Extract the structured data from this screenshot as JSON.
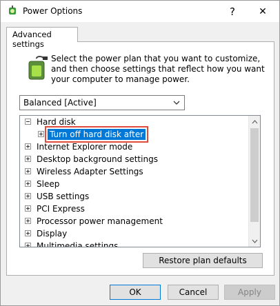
{
  "window": {
    "title": "Power Options",
    "help_label": "?",
    "close_label": "✕"
  },
  "tab": {
    "label": "Advanced settings"
  },
  "description": "Select the power plan that you want to customize, and then choose settings that reflect how you want your computer to manage power.",
  "plan_select": {
    "value": "Balanced [Active]"
  },
  "tree": {
    "items": [
      {
        "label": "Hard disk",
        "expander": "minus",
        "level": 0
      },
      {
        "label": "Turn off hard disk after",
        "expander": "plus",
        "level": 1,
        "selected": true
      },
      {
        "label": "Internet Explorer mode",
        "expander": "plus",
        "level": 0
      },
      {
        "label": "Desktop background settings",
        "expander": "plus",
        "level": 0
      },
      {
        "label": "Wireless Adapter Settings",
        "expander": "plus",
        "level": 0
      },
      {
        "label": "Sleep",
        "expander": "plus",
        "level": 0
      },
      {
        "label": "USB settings",
        "expander": "plus",
        "level": 0
      },
      {
        "label": "PCI Express",
        "expander": "plus",
        "level": 0
      },
      {
        "label": "Processor power management",
        "expander": "plus",
        "level": 0
      },
      {
        "label": "Display",
        "expander": "plus",
        "level": 0
      },
      {
        "label": "Multimedia settings",
        "expander": "plus",
        "level": 0
      }
    ]
  },
  "buttons": {
    "restore_defaults": "Restore plan defaults",
    "ok": "OK",
    "cancel": "Cancel",
    "apply": "Apply"
  },
  "colors": {
    "selection": "#0078d7",
    "highlight_box": "#e04a3c"
  }
}
